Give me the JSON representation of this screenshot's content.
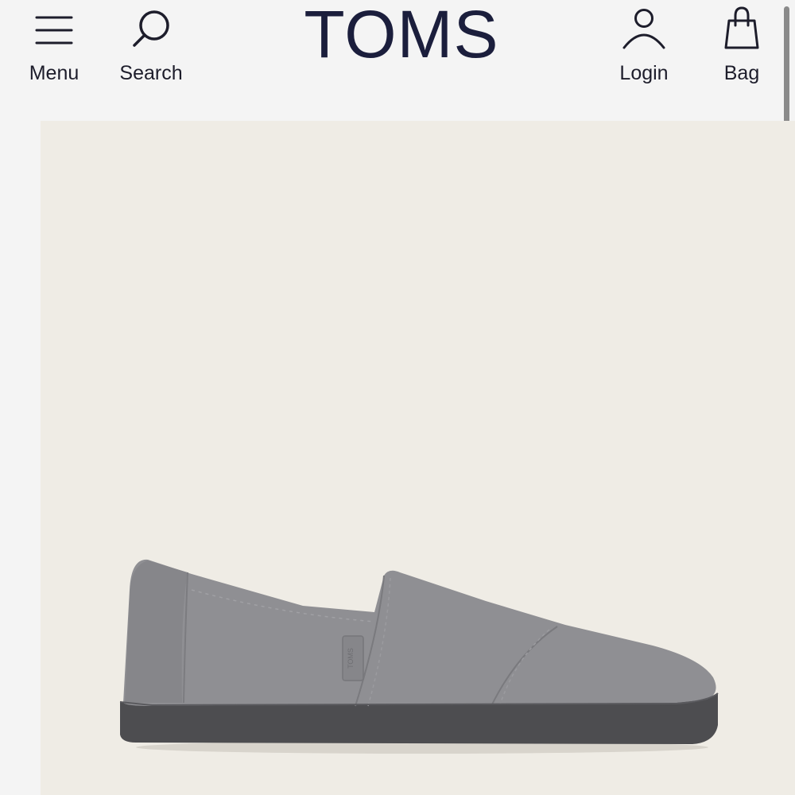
{
  "header": {
    "logo": "TOMS",
    "menu": {
      "label": "Menu",
      "icon": "menu-icon"
    },
    "search": {
      "label": "Search",
      "icon": "search-icon"
    },
    "login": {
      "label": "Login",
      "icon": "user-icon"
    },
    "bag": {
      "label": "Bag",
      "icon": "shopping-bag-icon"
    }
  },
  "product_image": {
    "subject": "grey suede slip-on shoe",
    "tag_text": "TOMS",
    "colors": {
      "background": "#efece5",
      "upper": "#8f8f93",
      "sole": "#4d4d50"
    }
  },
  "colors": {
    "page_background": "#f4f4f4",
    "logo": "#1b1e3c",
    "text": "#1d1d2b"
  }
}
